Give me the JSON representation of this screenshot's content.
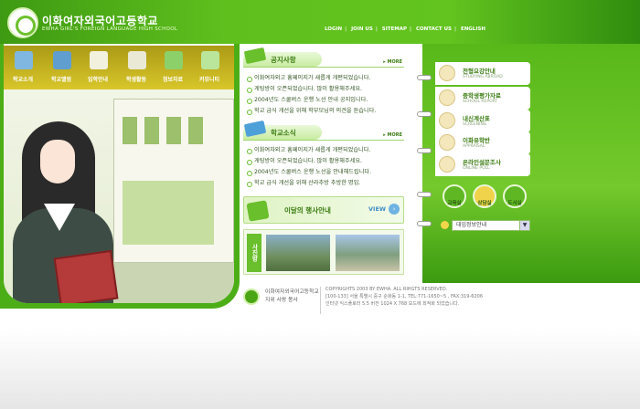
{
  "header": {
    "title": "이화여자외국어고등학교",
    "subtitle": "EWHA GIRL'S FOREIGN LANGUAGE HIGH SCHOOL",
    "nav": [
      "LOGIN",
      "JOIN US",
      "SITEMAP",
      "CONTACT US",
      "ENGLISH"
    ]
  },
  "menu": {
    "items": [
      "학교소개",
      "학교앨범",
      "입학안내",
      "학생활동",
      "정보자료",
      "커뮤니티"
    ]
  },
  "notice": {
    "title": "공지사항",
    "more": "MORE",
    "items": [
      "이화여자외고 홈페이지가 새롭게 개편되었습니다.",
      "게팅방이 오픈되었습니다. 많이 활용해주세요.",
      "2004년도 스쿨버스 운행 노선 안내 공지입니다.",
      "학교 급식 개선을 위해 학부모님의 의견을 듣습니다."
    ]
  },
  "news": {
    "title": "학교소식",
    "more": "MORE",
    "items": [
      "이화여자외고 홈페이지가 새롭게 개편되었습니다.",
      "게팅방이 오픈되었습니다. 많이 활용해주세요.",
      "2004년도 스쿨버스 운행 노선을 안내해드립니다.",
      "학교 급식 개선을 위해 산라추방 추방한 명입."
    ]
  },
  "event": {
    "title": "이달의 행사안내",
    "view": "VIEW"
  },
  "photo": {
    "label": "사진방"
  },
  "right_links": [
    {
      "title": "전형요강안내",
      "sub": "STUDYING ABROAD"
    },
    {
      "title": "중학생평가자료",
      "sub": "SCHOOL REPORT"
    },
    {
      "title": "내신계산표",
      "sub": "SCREENING"
    },
    {
      "title": "이화유학반",
      "sub": "APPRAISAL"
    },
    {
      "title": "온라인설문조사",
      "sub": "ONLINE POLL"
    }
  ],
  "quick": [
    "교육실",
    "상담실",
    "도서실"
  ],
  "select": {
    "value": "대입정보안내"
  },
  "footer": {
    "name_line1": "이화여자외국어고등학교",
    "name_line2": "지위 사랑 봉사",
    "copy_line1": "COPYRIGHTS 2003 BY EWHA. ALL RIHGTS RESERVED.",
    "copy_line2": "[100-133] 서울 특별시 중구 순화동 1-1, TEL:771-1650~5 , FAX:319-6206",
    "copy_line3": "인터넷 익스플로러 5.5 버전 1024 X 768 모드에 최적화 되었습니다."
  },
  "colors": {
    "brand_green": "#5fbf1d",
    "menu_olive": "#c9b522",
    "text_green": "#3b7c12"
  }
}
